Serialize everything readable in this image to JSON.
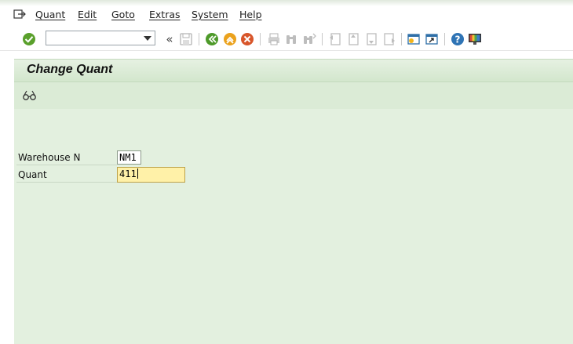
{
  "menu": {
    "items": [
      {
        "id": "quant",
        "label": "Quant"
      },
      {
        "id": "edit",
        "label": "Edit"
      },
      {
        "id": "goto",
        "label": "Goto"
      },
      {
        "id": "extras",
        "label": "Extras"
      },
      {
        "id": "system",
        "label": "System"
      },
      {
        "id": "help",
        "label": "Help"
      }
    ]
  },
  "toolbar": {
    "command_field_value": "",
    "nav_back_glyph": "«",
    "icons": [
      "enter-icon",
      "save-icon",
      "back-icon",
      "exit-icon",
      "cancel-icon",
      "print-icon",
      "find-icon",
      "find-next-icon",
      "first-page-icon",
      "previous-page-icon",
      "next-page-icon",
      "last-page-icon",
      "create-session-icon",
      "create-shortcut-icon",
      "help-icon",
      "customize-layout-icon"
    ]
  },
  "page": {
    "title": "Change Quant"
  },
  "form": {
    "warehouse_label": "Warehouse N",
    "warehouse_value": "NM1",
    "quant_label": "Quant",
    "quant_value": "411"
  },
  "colors": {
    "content_bg": "#e3f0df",
    "title_bg": "#d2e6cc",
    "active_field_bg": "#fff1a8"
  }
}
